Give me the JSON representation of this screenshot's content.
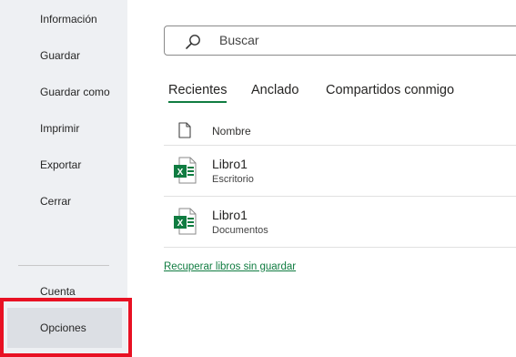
{
  "sidebar": {
    "items": [
      {
        "label": "Información"
      },
      {
        "label": "Guardar"
      },
      {
        "label": "Guardar como"
      },
      {
        "label": "Imprimir"
      },
      {
        "label": "Exportar"
      },
      {
        "label": "Cerrar"
      }
    ],
    "account_label": "Cuenta",
    "options_label": "Opciones"
  },
  "search": {
    "placeholder": "Buscar"
  },
  "tabs": [
    {
      "label": "Recientes",
      "active": true
    },
    {
      "label": "Anclado"
    },
    {
      "label": "Compartidos conmigo"
    }
  ],
  "files": {
    "column_name": "Nombre",
    "rows": [
      {
        "name": "Libro1",
        "location": "Escritorio",
        "icon": "excel-file-icon"
      },
      {
        "name": "Libro1",
        "location": "Documentos",
        "icon": "excel-file-icon"
      }
    ]
  },
  "recover_link": "Recuperar libros sin guardar",
  "colors": {
    "accent": "#107c41",
    "highlight": "#e81123",
    "sidebar_bg": "#eef0f3"
  }
}
